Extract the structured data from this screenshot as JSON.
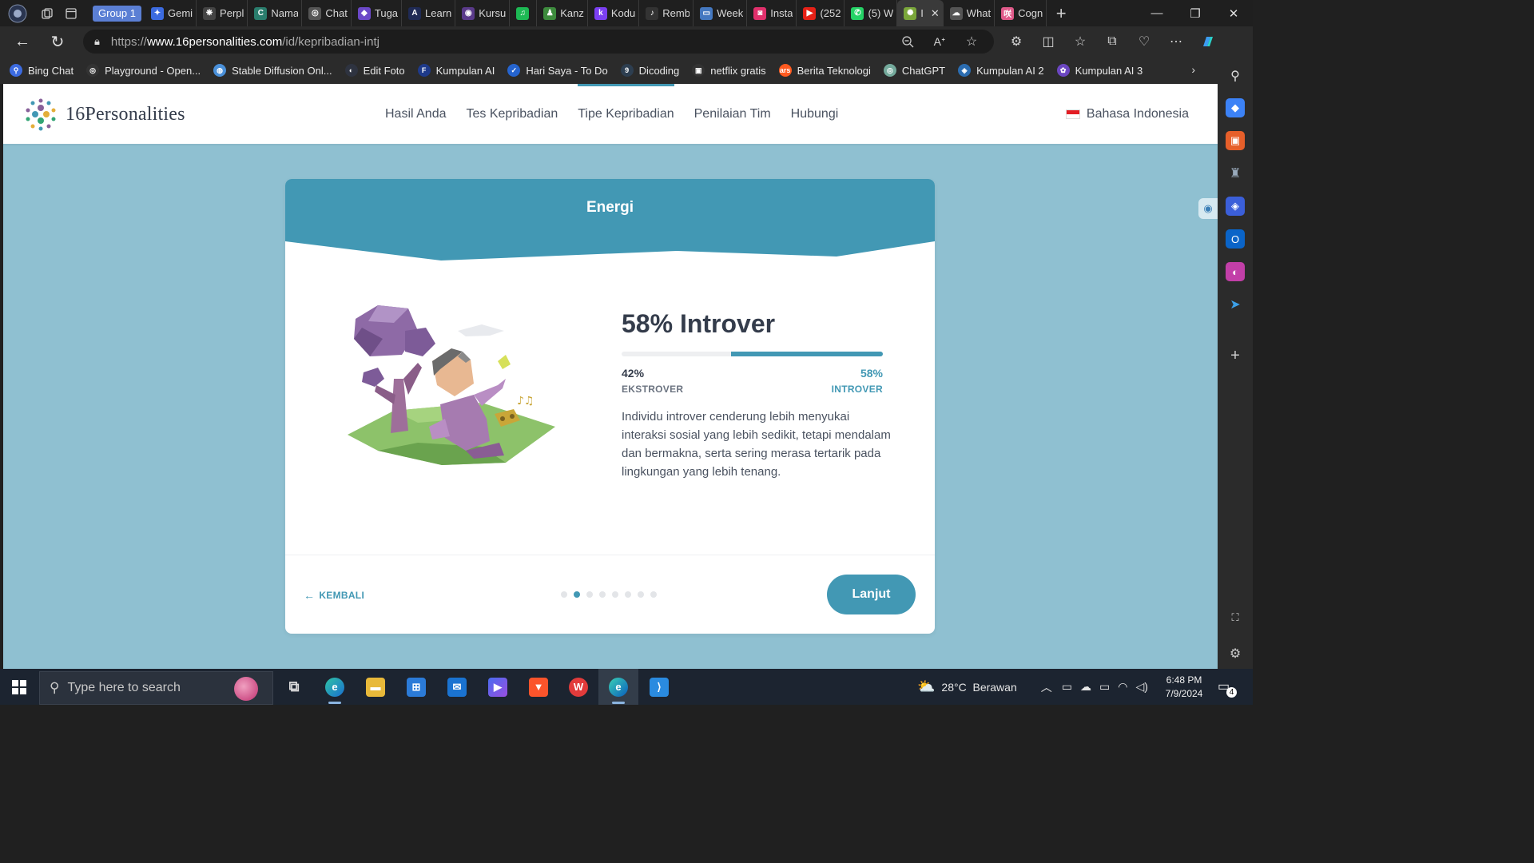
{
  "browser": {
    "tab_group_label": "Group 1",
    "tabs": [
      {
        "label": "Gemi",
        "color": "#3c6be0",
        "glyph": "✦"
      },
      {
        "label": "Perpl",
        "color": "#444",
        "glyph": "❋"
      },
      {
        "label": "Nama",
        "color": "#2a7d6d",
        "glyph": "C"
      },
      {
        "label": "Chat",
        "color": "#555",
        "glyph": "◎"
      },
      {
        "label": "Tuga",
        "color": "#6b48c8",
        "glyph": "◆"
      },
      {
        "label": "Learn",
        "color": "#1f2a55",
        "glyph": "A"
      },
      {
        "label": "Kursu",
        "color": "#5a3a8a",
        "glyph": "◉"
      },
      {
        "label": "",
        "color": "#1db954",
        "glyph": "♫"
      },
      {
        "label": "Kanz",
        "color": "#3d8b3d",
        "glyph": "♟"
      },
      {
        "label": "Kodu",
        "color": "#7b3ff2",
        "glyph": "k"
      },
      {
        "label": "Remb",
        "color": "#333",
        "glyph": "♪"
      },
      {
        "label": "Week",
        "color": "#4478c0",
        "glyph": "▭"
      },
      {
        "label": "Insta",
        "color": "#e1306c",
        "glyph": "◙"
      },
      {
        "label": "(252",
        "color": "#e62117",
        "glyph": "▶"
      },
      {
        "label": "(5) W",
        "color": "#25d366",
        "glyph": "✆"
      },
      {
        "label": "I",
        "color": "#7aa63a",
        "glyph": "✺"
      },
      {
        "label": "What",
        "color": "#555",
        "glyph": "☁"
      },
      {
        "label": "Cogn",
        "color": "#e05a8a",
        "glyph": "咲"
      }
    ],
    "active_tab_index": 15,
    "url_prefix": "https://",
    "url_host": "www.16personalities.com",
    "url_path": "/id/kepribadian-intj",
    "bookmarks": [
      {
        "label": "Bing Chat",
        "color": "#3c6be0",
        "glyph": "⚲"
      },
      {
        "label": "Playground - Open...",
        "color": "#333",
        "glyph": "◎"
      },
      {
        "label": "Stable Diffusion Onl...",
        "color": "#4a90d9",
        "glyph": "◍"
      },
      {
        "label": "Edit Foto",
        "color": "#2e3340",
        "glyph": "◐"
      },
      {
        "label": "Kumpulan AI",
        "color": "#1e3a8a",
        "glyph": "F"
      },
      {
        "label": "Hari Saya - To Do",
        "color": "#2564cf",
        "glyph": "✓"
      },
      {
        "label": "Dicoding",
        "color": "#2d3e50",
        "glyph": "9"
      },
      {
        "label": "netflix gratis",
        "color": "#333",
        "glyph": "▣"
      },
      {
        "label": "Berita Teknologi",
        "color": "#ff5a1f",
        "glyph": "ars"
      },
      {
        "label": "ChatGPT",
        "color": "#74aa9c",
        "glyph": "◎"
      },
      {
        "label": "Kumpulan AI 2",
        "color": "#2b6cb0",
        "glyph": "◈"
      },
      {
        "label": "Kumpulan AI 3",
        "color": "#6b46c1",
        "glyph": "✿"
      }
    ]
  },
  "site": {
    "logo_text": "16Personalities",
    "nav": [
      "Hasil Anda",
      "Tes Kepribadian",
      "Tipe Kepribadian",
      "Penilaian Tim",
      "Hubungi"
    ],
    "current_nav_index": 2,
    "language": "Bahasa Indonesia"
  },
  "card": {
    "title": "Energi",
    "result_title": "58% Introver",
    "left_percent": "42%",
    "left_label": "EKSTROVER",
    "right_percent": "58%",
    "right_label": "INTROVER",
    "bar_fill_fraction": 0.58,
    "description": "Individu introver cenderung lebih menyukai interaksi sosial yang lebih sedikit, tetapi mendalam dan bermakna, serta sering merasa tertarik pada lingkungan yang lebih tenang.",
    "back_label": "KEMBALI",
    "next_label": "Lanjut",
    "pagination_total": 8,
    "pagination_current": 1
  },
  "colors": {
    "accent": "#4298b4",
    "page_bg": "#8fc0d1",
    "text_dark": "#343c4b"
  },
  "taskbar": {
    "search_placeholder": "Type here to search",
    "weather": "28°C  Berawan",
    "time": "6:48 PM",
    "date": "7/9/2024",
    "notification_count": "4"
  }
}
